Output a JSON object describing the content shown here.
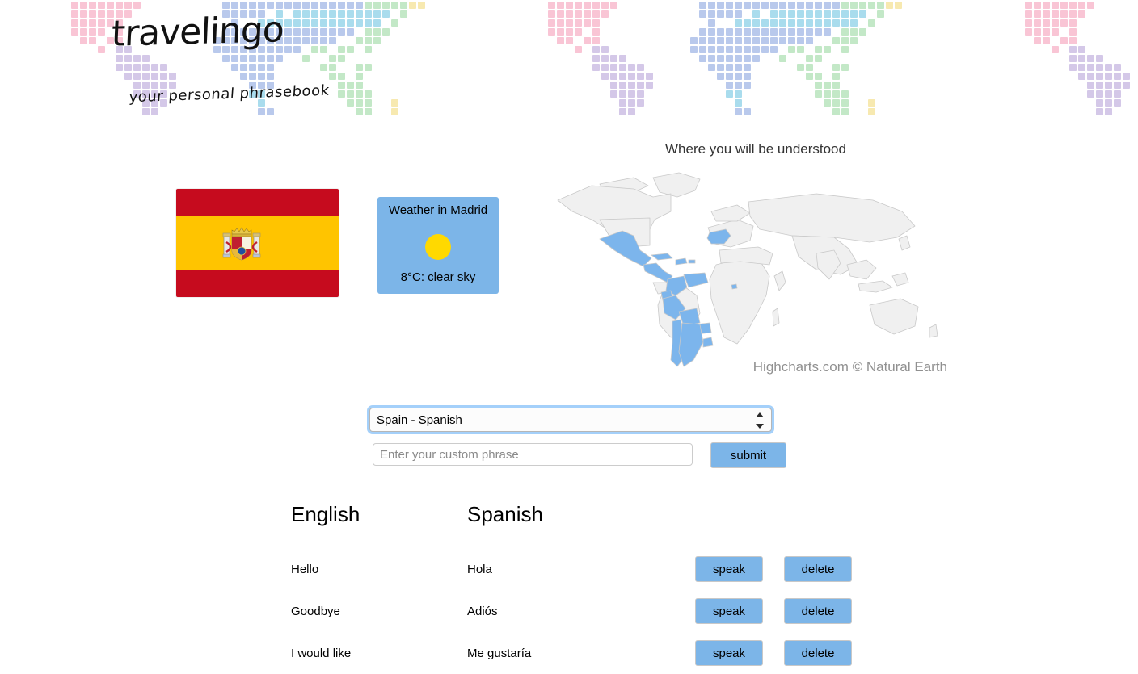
{
  "header": {
    "logo_title": "travelingo",
    "logo_tagline": "your personal phrasebook",
    "banner_colors": {
      "pink": "#f9c5d5",
      "blue": "#b9c9ec",
      "cyan": "#a9dced",
      "green": "#c3e8c7",
      "purple": "#d4c8e8",
      "yellow": "#f7e9b0"
    }
  },
  "map": {
    "title": "Where you will be understood",
    "credits": "Highcharts.com © Natural Earth",
    "highlight_color": "#7cb5ec",
    "base_color": "#f0f0f0",
    "border_color": "#c4c4c4",
    "highlighted_countries": [
      "Spain",
      "Mexico",
      "Guatemala",
      "Belize",
      "Honduras",
      "El Salvador",
      "Nicaragua",
      "Costa Rica",
      "Panama",
      "Cuba",
      "Dominican Republic",
      "Puerto Rico",
      "Colombia",
      "Venezuela",
      "Ecuador",
      "Peru",
      "Bolivia",
      "Paraguay",
      "Chile",
      "Argentina",
      "Uruguay",
      "Equatorial Guinea"
    ]
  },
  "flag": {
    "name": "Spain",
    "red": "#c60b1e",
    "yellow": "#ffc400"
  },
  "weather": {
    "city_label": "Weather in Madrid",
    "icon": "sun-icon",
    "icon_color": "#ffd900",
    "description": "8°C: clear sky",
    "card_color": "#7cb5e8"
  },
  "form": {
    "language_select_value": "Spain - Spanish",
    "language_options": [
      "Spain - Spanish"
    ],
    "phrase_placeholder": "Enter your custom phrase",
    "phrase_value": "",
    "submit_label": "submit",
    "button_color": "#7cb5e8"
  },
  "table": {
    "headers": [
      "English",
      "Spanish"
    ],
    "speak_label": "speak",
    "delete_label": "delete",
    "rows": [
      {
        "english": "Hello",
        "spanish": "Hola"
      },
      {
        "english": "Goodbye",
        "spanish": "Adiós"
      },
      {
        "english": "I would like",
        "spanish": "Me gustaría"
      }
    ]
  }
}
